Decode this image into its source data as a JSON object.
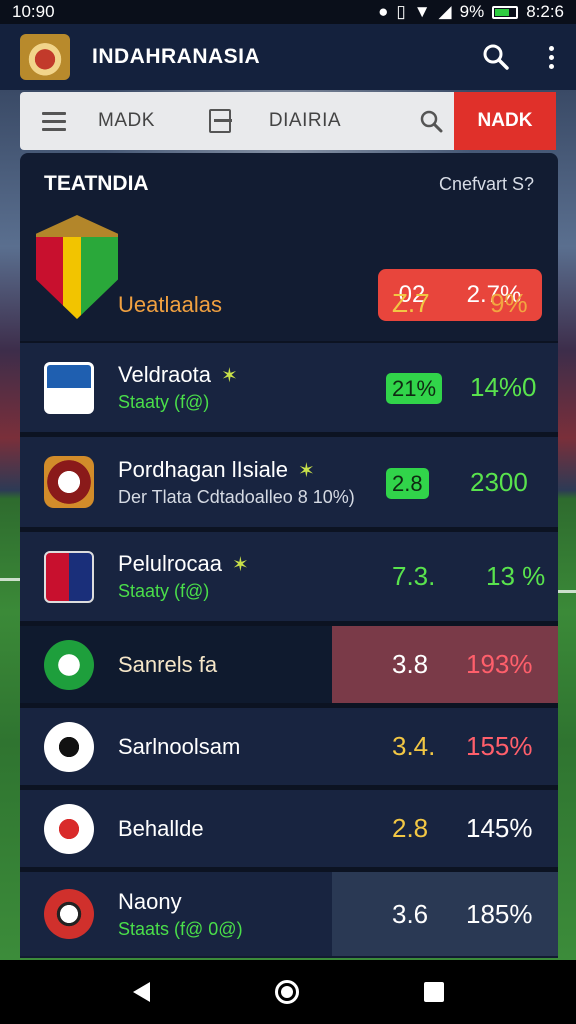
{
  "status_bar": {
    "time": "10:90",
    "battery_text": "9%",
    "clock_right": "8:2:6"
  },
  "app_bar": {
    "title": "INDAHRANASIA"
  },
  "toolbar": {
    "label_1": "MADK",
    "label_2": "DIAIRIA",
    "action": "NADK"
  },
  "card": {
    "title": "TEATNDIA",
    "filter": "Cnefvart S?"
  },
  "featured": {
    "name": "Ueatlaalas",
    "pill_left": "02",
    "pill_right": "2.7%",
    "value_1": "Z.7",
    "value_2": "9%"
  },
  "rows": [
    {
      "name": "Veldraota",
      "sub": "Staaty (f@)",
      "value_1": "21%",
      "value_2": "14%0"
    },
    {
      "name": "Pordhagan lIsiale",
      "sub": "Der Tlata Cdtadoalleo 8 10%)",
      "value_1": "2.8",
      "value_2": "2300"
    },
    {
      "name": "Pelulrocaa",
      "sub": "Staaty (f@)",
      "value_1": "7.3.",
      "value_2": "13 %"
    },
    {
      "name": "Sanrels fa",
      "value_1": "3.8",
      "value_2": "193%"
    },
    {
      "name": "Sarlnoolsam",
      "value_1": "3.4.",
      "value_2": "155%"
    },
    {
      "name": "Behallde",
      "value_1": "2.8",
      "value_2": "145%"
    },
    {
      "name": "Naony",
      "sub": "Staats (f@ 0@)",
      "value_1": "3.6",
      "value_2": "185%"
    }
  ],
  "colors": {
    "accent_red": "#e0302a",
    "positive_green": "#31d44a",
    "highlight_row": "#7a3a48"
  }
}
